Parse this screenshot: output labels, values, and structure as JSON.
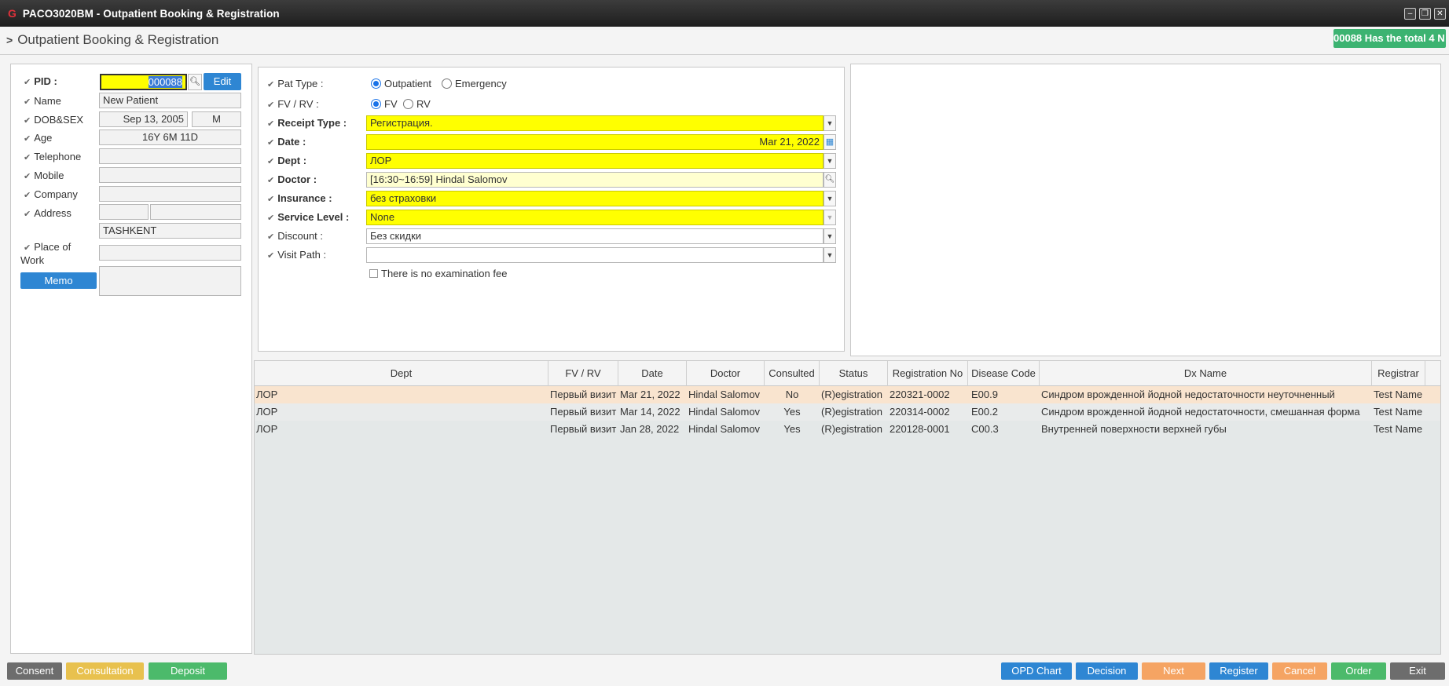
{
  "window": {
    "title": "PACO3020BM - Outpatient Booking & Registration",
    "logo": "G",
    "minimize": "–",
    "restore": "❐",
    "close": "✕"
  },
  "page": {
    "title": "Outpatient Booking & Registration",
    "marquee": "00088 Has the total 4 N"
  },
  "patient": {
    "pid_label": "PID :",
    "pid_value": "000088",
    "edit_label": "Edit",
    "name_label": "Name",
    "name_value": "New  Patient",
    "dob_label": "DOB&SEX",
    "dob_value": "Sep 13, 2005",
    "sex_value": "M",
    "age_label": "Age",
    "age_value": "16Y 6M 11D",
    "telephone_label": "Telephone",
    "telephone_value": "",
    "mobile_label": "Mobile",
    "mobile_value": "",
    "company_label": "Company",
    "company_value": "",
    "address_label": "Address",
    "address_zip": "",
    "address_line1": "",
    "address_city": "TASHKENT",
    "place_label_1": "Place of",
    "place_label_2": "Work",
    "place_value": "",
    "memo_label": "Memo",
    "memo_value": ""
  },
  "registration": {
    "pat_type_label": "Pat Type :",
    "pat_type_options": [
      "Outpatient",
      "Emergency"
    ],
    "fvrv_label": "FV / RV :",
    "fvrv_options": [
      "FV",
      "RV"
    ],
    "receipt_type_label": "Receipt Type :",
    "receipt_type_value": "Регистрация.",
    "date_label": "Date :",
    "date_value": "Mar 21, 2022",
    "dept_label": "Dept :",
    "dept_value": "ЛОР",
    "doctor_label": "Doctor :",
    "doctor_value": "[16:30~16:59] Hindal Salomov",
    "insurance_label": "Insurance :",
    "insurance_value": "без страховки",
    "service_level_label": "Service Level :",
    "service_level_value": "None",
    "discount_label": "Discount :",
    "discount_value": "Без скидки",
    "visit_path_label": "Visit Path :",
    "visit_path_value": "",
    "no_exam_fee_label": "There is no examination fee"
  },
  "table": {
    "columns": [
      "Dept",
      "FV / RV",
      "Date",
      "Doctor",
      "Consulted",
      "Status",
      "Registration No",
      "Disease Code",
      "Dx Name",
      "Registrar"
    ],
    "rows": [
      [
        "ЛОР",
        "Первый визит",
        "Mar 21, 2022",
        "Hindal Salomov",
        "No",
        "(R)egistration",
        "220321-0002",
        "E00.9",
        "Синдром врожденной йодной недостаточности неуточненный",
        "Test Name"
      ],
      [
        "ЛОР",
        "Первый визит",
        "Mar 14, 2022",
        "Hindal Salomov",
        "Yes",
        "(R)egistration",
        "220314-0002",
        "E00.2",
        "Синдром врожденной йодной недостаточности, смешанная форма",
        "Test Name"
      ],
      [
        "ЛОР",
        "Первый визит",
        "Jan 28, 2022",
        "Hindal Salomov",
        "Yes",
        "(R)egistration",
        "220128-0001",
        "C00.3",
        "Внутренней поверхности верхней губы",
        "Test Name"
      ]
    ]
  },
  "footer": {
    "consent": "Consent",
    "consultation": "Consultation",
    "deposit": "Deposit",
    "opd_chart": "OPD Chart",
    "decision": "Decision",
    "next": "Next",
    "register": "Register",
    "cancel": "Cancel",
    "order": "Order",
    "exit": "Exit"
  },
  "colors": {
    "required_field": "#ffff00",
    "blue_button": "#2e86d3",
    "orange_button": "#f5a463",
    "green_button": "#4cba6b",
    "gray_button": "#6d6d6d",
    "yellow_button": "#e8c14e",
    "selected_row": "#f9e4cf"
  }
}
